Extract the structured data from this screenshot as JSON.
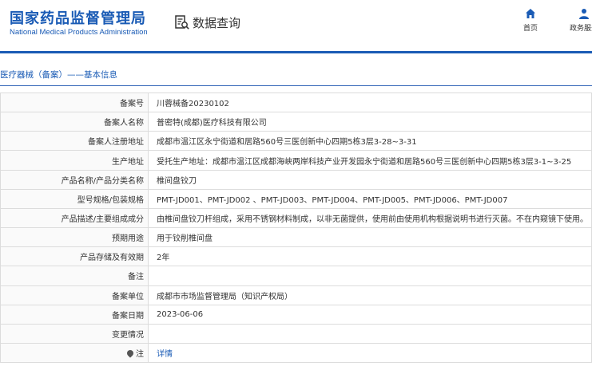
{
  "header": {
    "title_cn": "国家药品监督管理局",
    "title_en": "National Medical Products Administration",
    "search_label": "数据查询",
    "nav": [
      {
        "label": "首页",
        "icon": "home-icon"
      },
      {
        "label": "政务服务",
        "icon": "user-icon"
      }
    ]
  },
  "breadcrumb": "医疗器械（备案）——基本信息",
  "accent_color": "#1a5bb5",
  "fields": [
    {
      "label": "备案号",
      "value": "川蓉械备20230102"
    },
    {
      "label": "备案人名称",
      "value": "普密特(成都)医疗科技有限公司"
    },
    {
      "label": "备案人注册地址",
      "value": "成都市温江区永宁街道和居路560号三医创新中心四期5栋3层3-28~3-31"
    },
    {
      "label": "生产地址",
      "value": "受托生产地址：成都市温江区成都海峡两岸科技产业开发园永宁街道和居路560号三医创新中心四期5栋3层3-1~3-25"
    },
    {
      "label": "产品名称/产品分类名称",
      "value": "椎间盘铰刀"
    },
    {
      "label": "型号规格/包装规格",
      "value": "PMT-JD001、PMT-JD002 、PMT-JD003、PMT-JD004、PMT-JD005、PMT-JD006、PMT-JD007"
    },
    {
      "label": "产品描述/主要组成成分",
      "value": "由椎间盘铰刀杆组成，采用不锈钢材料制成，以非无菌提供，使用前由使用机构根据说明书进行灭菌。不在内窥镜下使用。"
    },
    {
      "label": "预期用途",
      "value": "用于铰削椎间盘"
    },
    {
      "label": "产品存储及有效期",
      "value": "2年"
    },
    {
      "label": "备注",
      "value": ""
    },
    {
      "label": "备案单位",
      "value": "成都市市场监督管理局（知识产权局）"
    },
    {
      "label": "备案日期",
      "value": "2023-06-06"
    },
    {
      "label": "变更情况",
      "value": ""
    },
    {
      "label": "注",
      "value": "详情"
    }
  ]
}
